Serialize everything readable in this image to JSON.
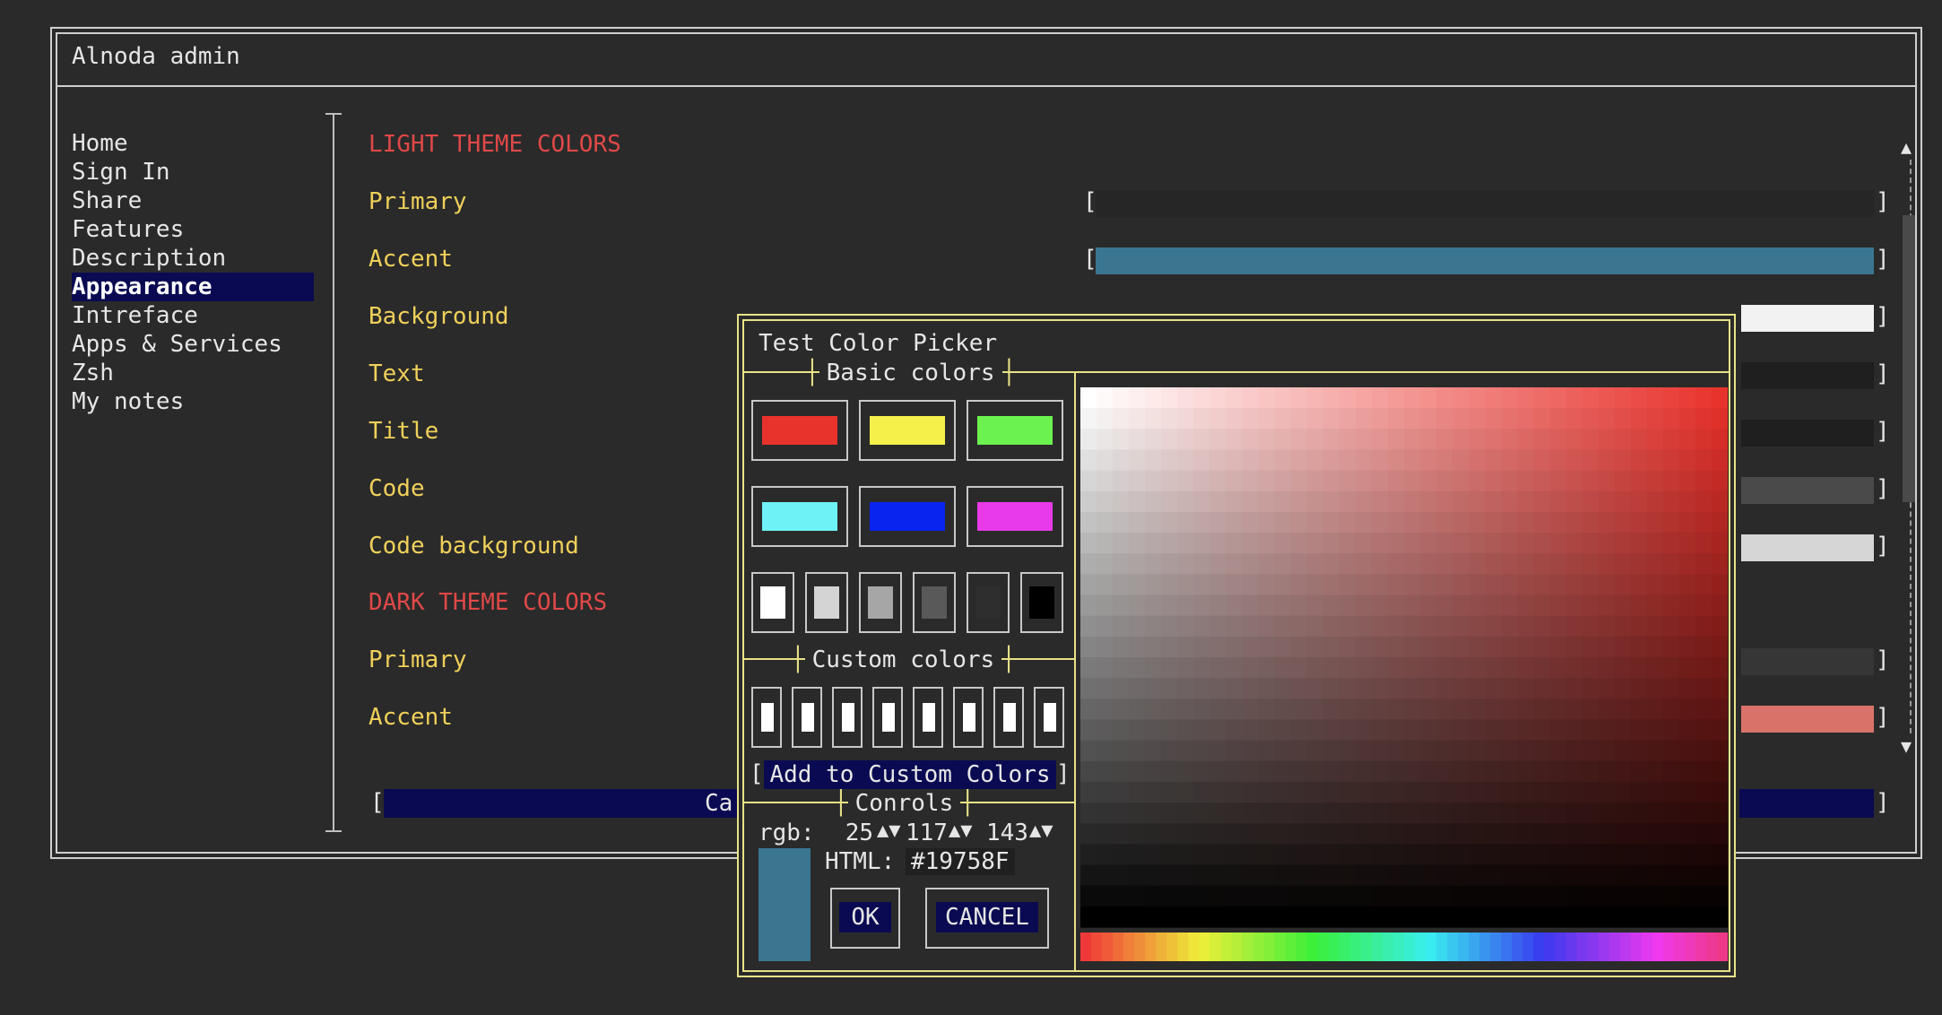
{
  "window": {
    "title": "Alnoda admin"
  },
  "sidebar": {
    "items": [
      {
        "label": "Home",
        "active": false
      },
      {
        "label": "Sign In",
        "active": false
      },
      {
        "label": "Share",
        "active": false
      },
      {
        "label": "Features",
        "active": false
      },
      {
        "label": "Description",
        "active": false
      },
      {
        "label": "Appearance",
        "active": true
      },
      {
        "label": "Intreface",
        "active": false
      },
      {
        "label": "Apps & Services",
        "active": false
      },
      {
        "label": "Zsh",
        "active": false
      },
      {
        "label": "My notes",
        "active": false
      }
    ]
  },
  "form": {
    "light_header": "LIGHT THEME COLORS",
    "dark_header": "DARK THEME COLORS",
    "rows": [
      {
        "label": "Primary",
        "color": "#262626"
      },
      {
        "label": "Accent",
        "color": "#3b7691"
      },
      {
        "label": "Background",
        "color": "#f2f2f2"
      },
      {
        "label": "Text",
        "color": "#1f1f1f"
      },
      {
        "label": "Title",
        "color": "#1f1f1f"
      },
      {
        "label": "Code",
        "color": "#4a4a4a"
      },
      {
        "label": "Code background",
        "color": "#d6d6d6"
      }
    ],
    "dark_rows": [
      {
        "label": "Primary",
        "color": "#363636"
      },
      {
        "label": "Accent",
        "color": "#d9736a"
      }
    ],
    "bottom_button": "Ca",
    "bracket_open": "[",
    "bracket_close": "]"
  },
  "scrollbar": {
    "up_icon": "▲",
    "down_icon": "▼"
  },
  "dialog": {
    "title": "Test Color Picker",
    "basic_colors_title": "Basic colors",
    "custom_colors_title": "Custom colors",
    "controls_title": "Conrols",
    "add_custom": "Add to Custom Colors",
    "basic_colors": [
      "#e8322c",
      "#f5f04a",
      "#6cf24e",
      "#6ef2f5",
      "#0a24f0",
      "#e83ae8"
    ],
    "grays": [
      "#ffffff",
      "#d4d4d4",
      "#a6a6a6",
      "#595959",
      "#2e2e2e",
      "#000000"
    ],
    "custom_count": 8,
    "rgb_label": "rgb:",
    "r": "25",
    "g": "117",
    "b": "143",
    "spin_icon": "▲▼",
    "html_label": "HTML:",
    "html_value": "#19758F",
    "preview_color": "#3b7691",
    "ok": "OK",
    "cancel": "CANCEL",
    "palette_hue_color": "#e8322c"
  }
}
